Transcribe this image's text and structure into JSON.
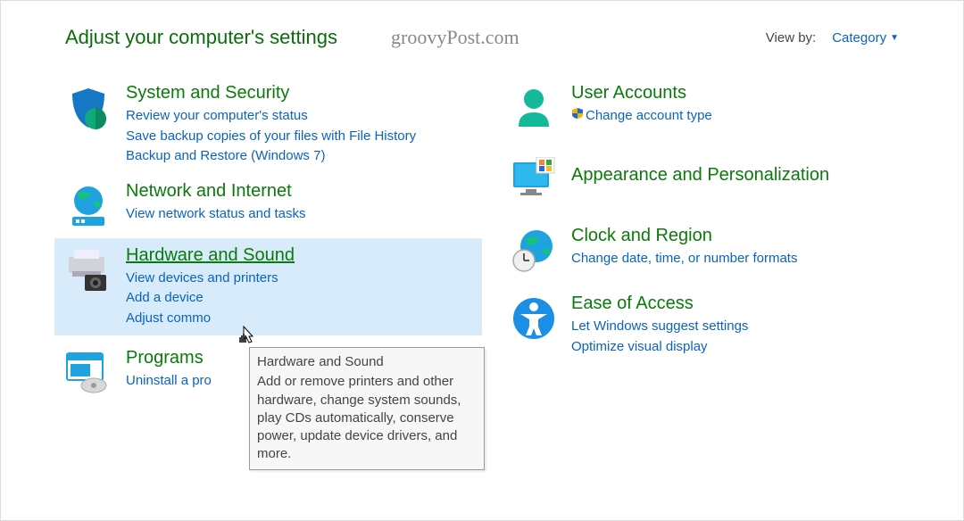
{
  "header": {
    "title": "Adjust your computer's settings",
    "watermark": "groovyPost.com",
    "viewby_label": "View by:",
    "viewby_value": "Category"
  },
  "left": {
    "system": {
      "title": "System and Security",
      "links": [
        "Review your computer's status",
        "Save backup copies of your files with File History",
        "Backup and Restore (Windows 7)"
      ]
    },
    "network": {
      "title": "Network and Internet",
      "links": [
        "View network status and tasks"
      ]
    },
    "hardware": {
      "title": "Hardware and Sound",
      "links": [
        "View devices and printers",
        "Add a device",
        "Adjust commo"
      ]
    },
    "programs": {
      "title": "Programs",
      "links": [
        "Uninstall a pro"
      ]
    }
  },
  "right": {
    "user": {
      "title": "User Accounts",
      "links": [
        "Change account type"
      ]
    },
    "appearance": {
      "title": "Appearance and Personalization"
    },
    "clock": {
      "title": "Clock and Region",
      "links": [
        "Change date, time, or number formats"
      ]
    },
    "ease": {
      "title": "Ease of Access",
      "links": [
        "Let Windows suggest settings",
        "Optimize visual display"
      ]
    }
  },
  "tooltip": {
    "title": "Hardware and Sound",
    "body": "Add or remove printers and other hardware, change system sounds, play CDs automatically, conserve power, update device drivers, and more."
  }
}
